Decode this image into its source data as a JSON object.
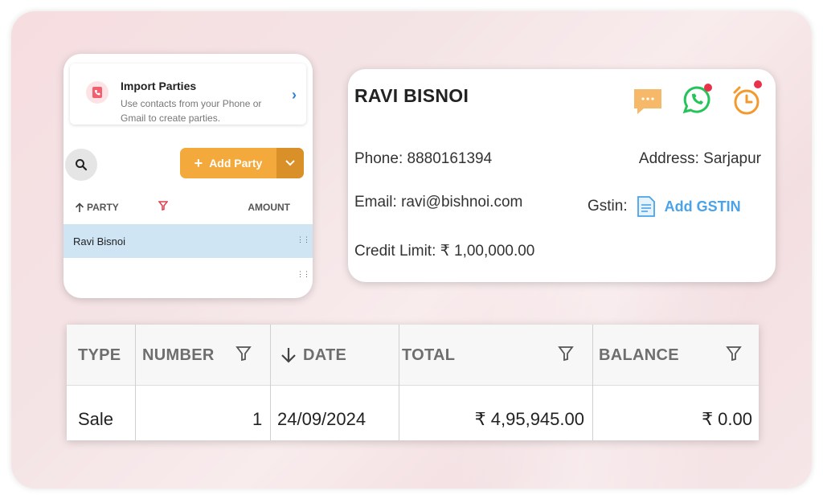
{
  "import_card": {
    "title": "Import Parties",
    "desc_line1": "Use contacts from your Phone or",
    "desc_line2": "Gmail to create parties."
  },
  "parties_panel": {
    "add_party_label": "Add Party",
    "col_party": "PARTY",
    "col_amount": "AMOUNT",
    "rows": [
      {
        "name": "Ravi Bisnoi"
      }
    ]
  },
  "party_detail": {
    "name": "RAVI BISNOI",
    "phone": "Phone: 8880161394",
    "address": "Address: Sarjapur",
    "email": "Email: ravi@bishnoi.com",
    "gstin_label": "Gstin:",
    "add_gstin": "Add GSTIN",
    "credit_limit": "Credit Limit: ₹ 1,00,000.00"
  },
  "transactions": {
    "headers": [
      "TYPE",
      "NUMBER",
      "DATE",
      "TOTAL",
      "BALANCE"
    ],
    "rows": [
      {
        "type": "Sale",
        "number": "1",
        "date": "24/09/2024",
        "total": "₹ 4,95,945.00",
        "balance": "₹ 0.00"
      }
    ]
  },
  "colors": {
    "accent_orange": "#f3a93b",
    "selected_row": "#cfe5f3",
    "link_blue": "#4aa3e8",
    "whatsapp_green": "#25c45a",
    "notification_red": "#e8324a"
  }
}
